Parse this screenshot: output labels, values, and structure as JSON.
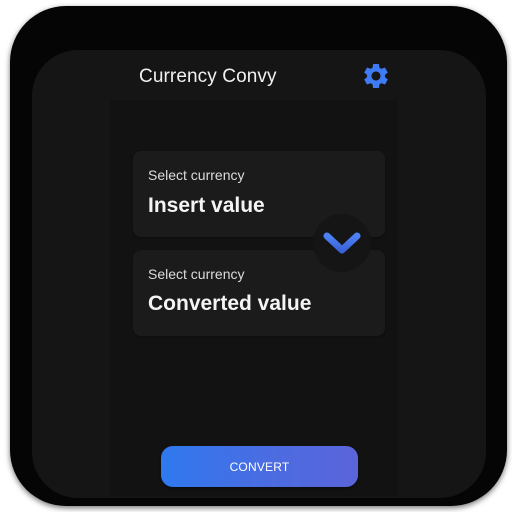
{
  "app": {
    "title": "Currency Convy"
  },
  "header": {
    "settings_icon": "gear-icon",
    "settings_color": "#3F7BF2"
  },
  "from_currency": {
    "label": "Select currency",
    "value": "Insert value"
  },
  "to_currency": {
    "label": "Select currency",
    "value": "Converted value"
  },
  "swap": {
    "icon": "chevron-down-icon",
    "color": "#4D7CF3"
  },
  "actions": {
    "convert_label": "CONVERT"
  },
  "colors": {
    "background": "#151515",
    "card": "#1B1B1B",
    "accent": "#3F7BF2"
  }
}
